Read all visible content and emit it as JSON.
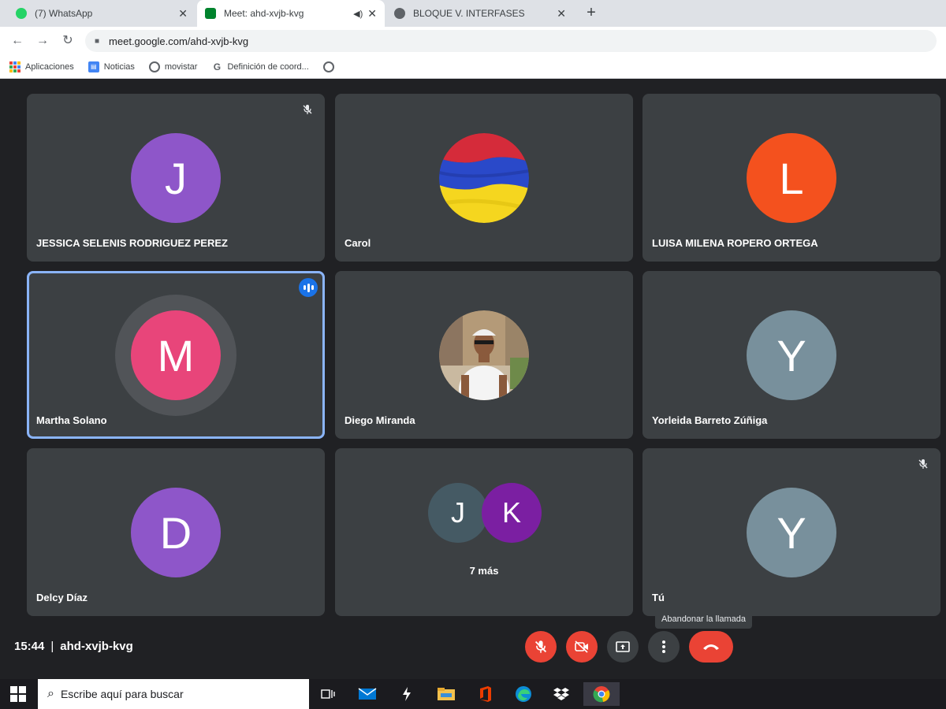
{
  "browser": {
    "tabs": [
      {
        "title": "(7) WhatsApp",
        "active": false,
        "favicon_color": "#25d366"
      },
      {
        "title": "Meet: ahd-xvjb-kvg",
        "active": true,
        "favicon_color": "#00832d"
      },
      {
        "title": "BLOQUE V. INTERFASES",
        "active": false,
        "favicon_color": "#5f6368"
      }
    ],
    "new_tab": "+",
    "url": "meet.google.com/ahd-xvjb-kvg",
    "bookmarks": [
      {
        "label": "Aplicaciones",
        "icon": "apps-grid-icon"
      },
      {
        "label": "Noticias",
        "icon": "news-icon"
      },
      {
        "label": "movistar",
        "icon": "globe-icon"
      },
      {
        "label": "Definición de coord...",
        "icon": "g-translate-icon"
      },
      {
        "label": "",
        "icon": "globe-icon"
      }
    ]
  },
  "meet": {
    "participants": [
      {
        "name": "JESSICA SELENIS RODRIGUEZ PEREZ",
        "initial": "J",
        "avatar_color": "#8e56c9",
        "muted": true,
        "speaking": false
      },
      {
        "name": "Carol",
        "initial": "",
        "avatar_type": "flag-photo",
        "muted": false,
        "speaking": false
      },
      {
        "name": "LUISA MILENA ROPERO ORTEGA",
        "initial": "L",
        "avatar_color": "#f4511e",
        "muted": false,
        "speaking": false
      },
      {
        "name": "Martha Solano",
        "initial": "M",
        "avatar_color": "#e8457a",
        "muted": false,
        "speaking": true
      },
      {
        "name": "Diego Miranda",
        "initial": "",
        "avatar_type": "person-photo",
        "muted": false,
        "speaking": false
      },
      {
        "name": "Yorleida Barreto Zúñiga",
        "initial": "Y",
        "avatar_color": "#78909c",
        "muted": false,
        "speaking": false
      },
      {
        "name": "Delcy Díaz",
        "initial": "D",
        "avatar_color": "#8e56c9",
        "muted": false,
        "speaking": false
      },
      {
        "name": "",
        "more_group": true,
        "initials": [
          "J",
          "K"
        ],
        "colors": [
          "#455a64",
          "#7b1fa2"
        ],
        "more_label": "7 más"
      },
      {
        "name": "Tú",
        "initial": "Y",
        "avatar_color": "#78909c",
        "muted": true,
        "speaking": false
      }
    ],
    "time": "15:44",
    "meeting_code": "ahd-xvjb-kvg",
    "tooltip": "Abandonar la llamada",
    "controls": [
      "mic-off-icon",
      "camera-off-icon",
      "present-icon",
      "more-vert-icon",
      "hangup-icon"
    ]
  },
  "taskbar": {
    "search_placeholder": "Escribe aquí para buscar",
    "apps": [
      "task-view-icon",
      "mail-icon",
      "bolt-icon",
      "file-explorer-icon",
      "office-icon",
      "edge-icon",
      "dropbox-icon",
      "chrome-icon"
    ]
  }
}
